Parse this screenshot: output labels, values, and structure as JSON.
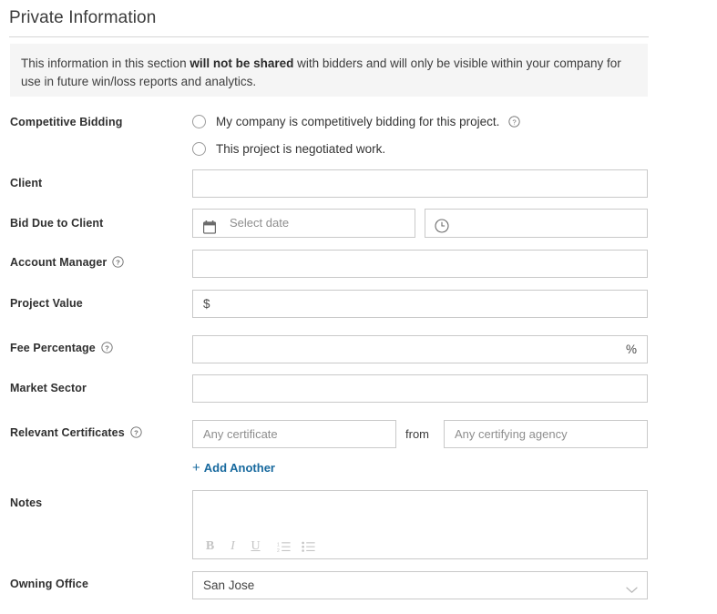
{
  "section": {
    "title": "Private Information",
    "banner": {
      "text_before": "This information in this section ",
      "text_bold": "will not be shared",
      "text_after": " with bidders and will only be visible within your company for use in future win/loss reports and analytics."
    }
  },
  "fields": {
    "competitive_bidding": {
      "label": "Competitive Bidding",
      "option_1": "My company is competitively bidding for this project.",
      "option_2": "This project is negotiated work.",
      "help_icon": "question-circle-icon"
    },
    "client": {
      "label": "Client",
      "value": "",
      "placeholder": ""
    },
    "bid_due_to_client": {
      "label": "Bid Due to Client",
      "date_placeholder": "Select date",
      "date_icon": "calendar-icon",
      "time_value": "",
      "time_icon": "clock-icon"
    },
    "account_manager": {
      "label": "Account Manager",
      "value": "",
      "help_icon": "question-circle-icon"
    },
    "project_value": {
      "label": "Project Value",
      "prefix": "$",
      "value": ""
    },
    "fee_percentage": {
      "label": "Fee Percentage",
      "suffix": "%",
      "value": "",
      "help_icon": "question-circle-icon"
    },
    "market_sector": {
      "label": "Market Sector",
      "value": ""
    },
    "relevant_certificates": {
      "label": "Relevant Certificates",
      "help_icon": "question-circle-icon",
      "certificate_placeholder": "Any certificate",
      "joiner": "from",
      "agency_placeholder": "Any certifying agency",
      "add_another_label": "Add Another",
      "add_another_plus": "+"
    },
    "notes": {
      "label": "Notes",
      "value": "",
      "toolbar": {
        "bold": "B",
        "italic": "I",
        "underline": "U",
        "ordered_list": "ordered-list-icon",
        "bullet_list": "bullet-list-icon"
      }
    },
    "owning_office": {
      "label": "Owning Office",
      "value": "San Jose",
      "chevron": "chevron-down-icon"
    }
  },
  "colors": {
    "link": "#17699e",
    "banner_bg": "#f5f5f5",
    "border": "#c9c9c9",
    "text": "#333333"
  }
}
